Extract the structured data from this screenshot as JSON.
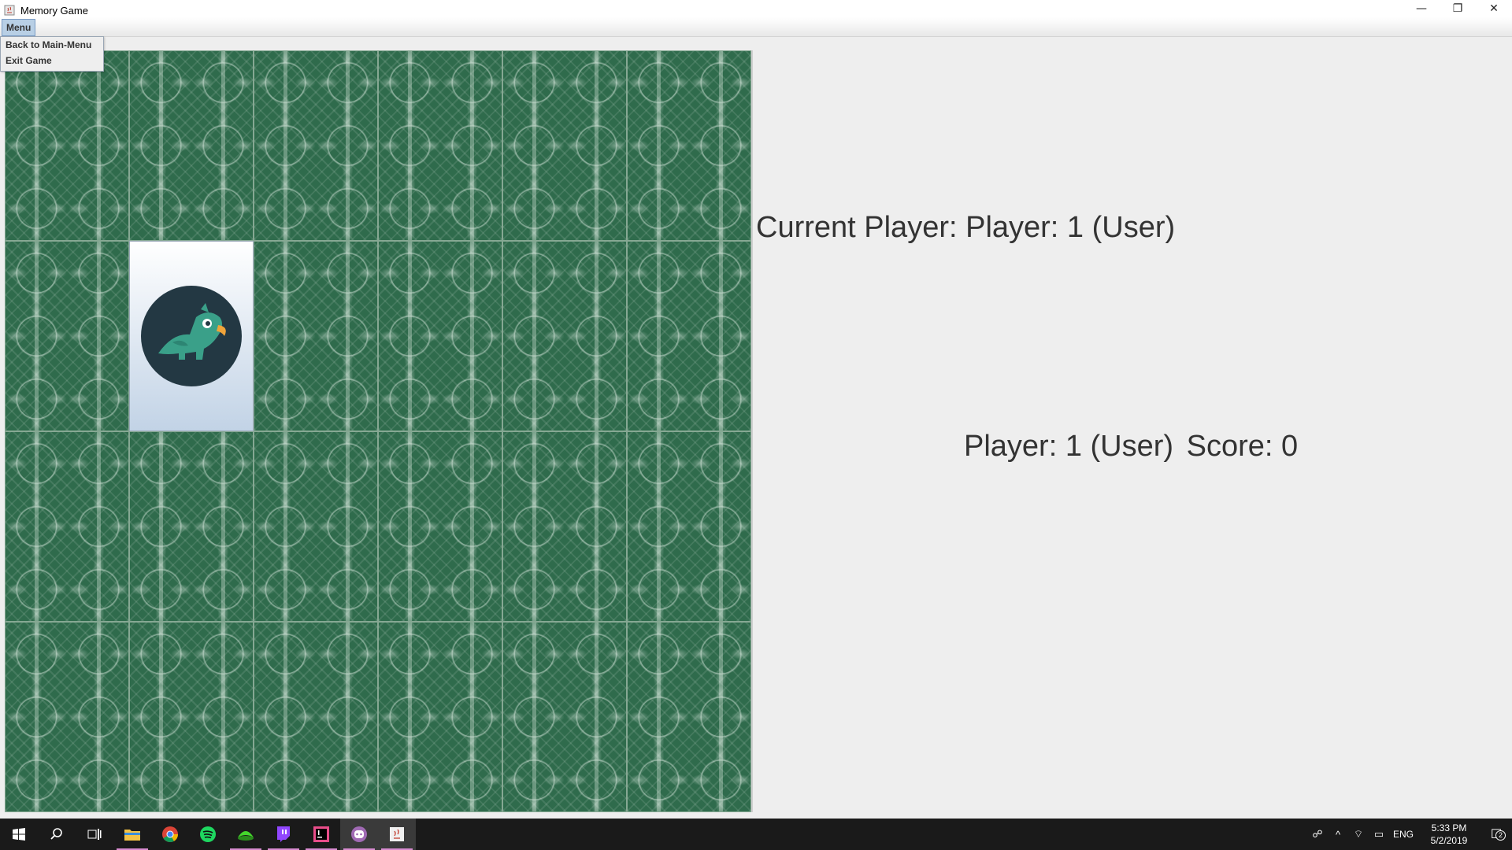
{
  "window": {
    "title": "Memory Game",
    "minimize_glyph": "—",
    "restore_glyph": "❐",
    "close_glyph": "✕"
  },
  "menu": {
    "label": "Menu",
    "items": [
      {
        "label": "Back to Main-Menu"
      },
      {
        "label": "Exit Game"
      }
    ]
  },
  "board": {
    "rows": 4,
    "cols": 6,
    "face_up_cards": [
      {
        "row": 1,
        "col": 1,
        "icon": "parrot-icon"
      }
    ],
    "card_back_color": "#2f6b4c"
  },
  "info": {
    "current_player": "Current Player: Player: 1 (User)",
    "player": "Player: 1 (User)",
    "score": "Score: 0"
  },
  "taskbar": {
    "apps": [
      {
        "name": "file-explorer-icon"
      },
      {
        "name": "chrome-icon"
      },
      {
        "name": "spotify-icon"
      },
      {
        "name": "razer-icon"
      },
      {
        "name": "twitch-icon"
      },
      {
        "name": "intellij-icon"
      },
      {
        "name": "discord-icon"
      },
      {
        "name": "java-icon"
      }
    ],
    "language": "ENG",
    "time": "5:33 PM",
    "date": "5/2/2019",
    "notification_count": "2"
  }
}
